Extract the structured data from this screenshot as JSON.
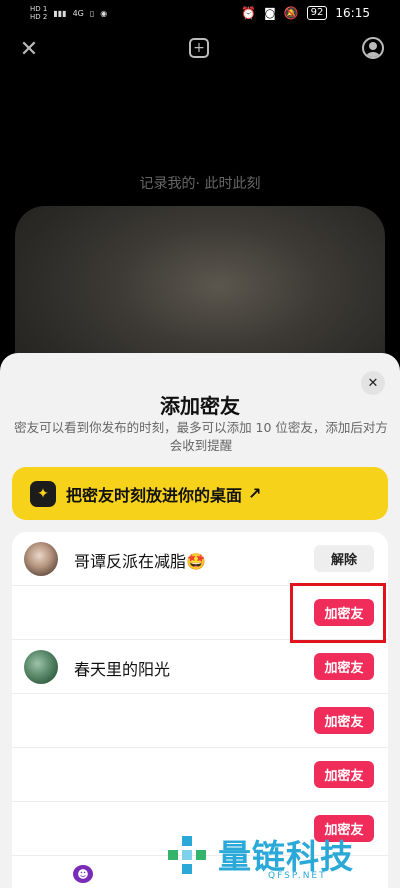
{
  "status_bar": {
    "sim1": "HD 1",
    "sim2": "HD 2",
    "network": "4G",
    "battery": "92",
    "time": "16:15"
  },
  "top_bar": {
    "close_icon": "close-icon",
    "add_icon": "add-square-icon",
    "profile_icon": "profile-icon"
  },
  "camera": {
    "record_text": "记录我的· 此时此刻"
  },
  "sheet": {
    "title": "添加密友",
    "description": "密友可以看到你发布的时刻，最多可以添加 10 位密友，添加后对方会收到提醒",
    "cta": {
      "label": "把密友时刻放进你的桌面",
      "arrow": "↗"
    },
    "friends": [
      {
        "name": "哥谭反派在减脂🤩",
        "action": "解除",
        "status": "friend",
        "avatar": "photo"
      },
      {
        "name": "",
        "action": "加密友",
        "status": "add",
        "avatar": "blank"
      },
      {
        "name": "春天里的阳光",
        "action": "加密友",
        "status": "add",
        "avatar": "plant"
      },
      {
        "name": "",
        "action": "加密友",
        "status": "add",
        "avatar": "blank"
      },
      {
        "name": "",
        "action": "加密友",
        "status": "add",
        "avatar": "blank"
      },
      {
        "name": "",
        "action": "加密友",
        "status": "add",
        "avatar": "blank"
      }
    ]
  },
  "watermark": {
    "text": "量链科技",
    "sub": "QFSP.NET"
  },
  "colors": {
    "accent_yellow": "#f7d21a",
    "add_button": "#f02d5a",
    "highlight_box": "#e0141c",
    "watermark": "#2aa9d8"
  }
}
